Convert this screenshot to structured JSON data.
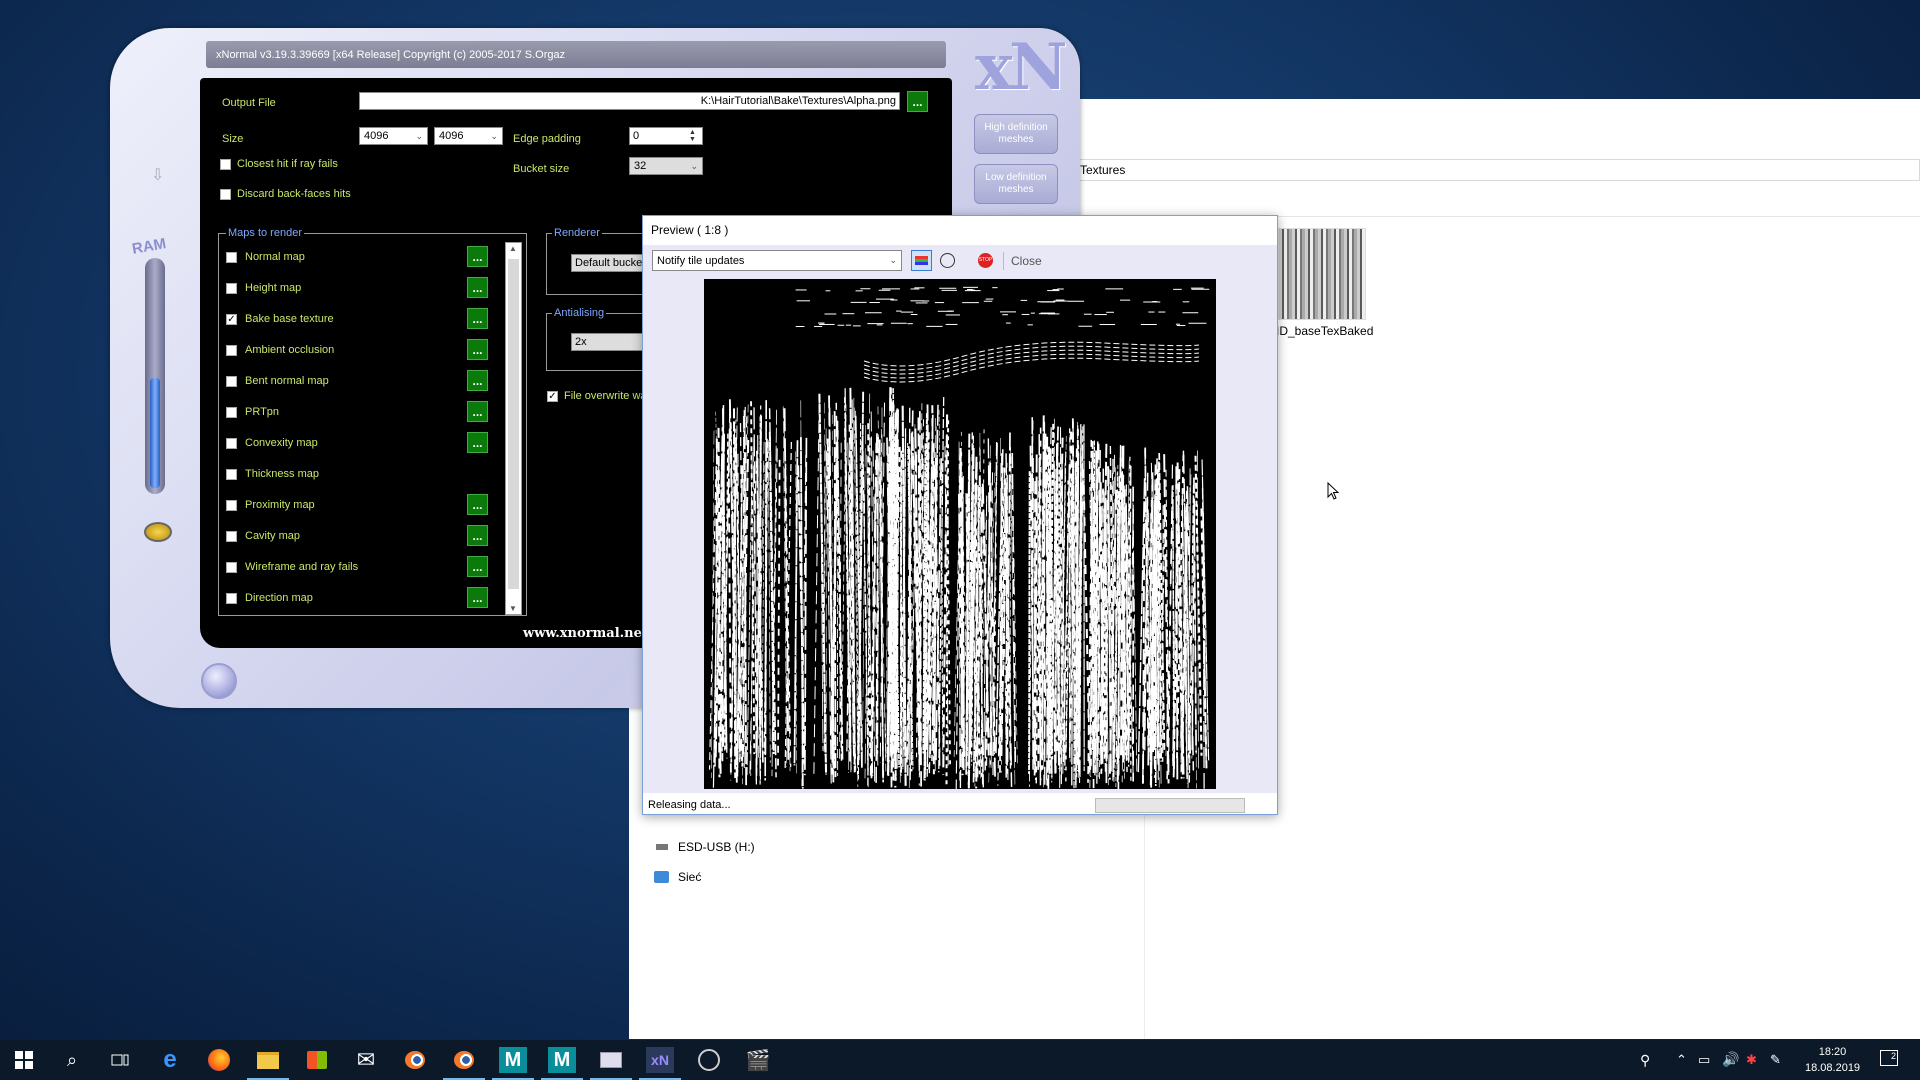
{
  "xnormal": {
    "title": "xNormal v3.19.3.39669 [x64 Release] Copyright (c) 2005-2017 S.Orgaz",
    "logo": "xN",
    "output_file_label": "Output File",
    "output_file_value": "K:\\HairTutorial\\Bake\\Textures\\Alpha.png",
    "browse_label": "...",
    "size_label": "Size",
    "size_w": "4096",
    "size_h": "4096",
    "edge_padding_label": "Edge padding",
    "edge_padding_value": "0",
    "bucket_size_label": "Bucket size",
    "bucket_size_value": "32",
    "closest_hit_label": "Closest hit if ray fails",
    "discard_backfaces_label": "Discard back-faces hits",
    "maps_group_label": "Maps to render",
    "maps": [
      {
        "label": "Normal map",
        "checked": false,
        "has_options": true
      },
      {
        "label": "Height map",
        "checked": false,
        "has_options": true
      },
      {
        "label": "Bake base texture",
        "checked": true,
        "has_options": true
      },
      {
        "label": "Ambient occlusion",
        "checked": false,
        "has_options": true
      },
      {
        "label": "Bent normal map",
        "checked": false,
        "has_options": true
      },
      {
        "label": "PRTpn",
        "checked": false,
        "has_options": true
      },
      {
        "label": "Convexity map",
        "checked": false,
        "has_options": true
      },
      {
        "label": "Thickness map",
        "checked": false,
        "has_options": false
      },
      {
        "label": "Proximity map",
        "checked": false,
        "has_options": true
      },
      {
        "label": "Cavity map",
        "checked": false,
        "has_options": true
      },
      {
        "label": "Wireframe and ray fails",
        "checked": false,
        "has_options": true
      },
      {
        "label": "Direction map",
        "checked": false,
        "has_options": true
      }
    ],
    "renderer_label": "Renderer",
    "renderer_value": "Default bucke",
    "antialiasing_label": "Antialising",
    "antialiasing_value": "2x",
    "file_overwrite_label": "File overwrite wa",
    "ram_label": "RAM",
    "ram_level": 0.5,
    "high_def_btn": "High definition meshes",
    "low_def_btn": "Low definition meshes",
    "website": "www.xnormal.net"
  },
  "preview": {
    "title": "Preview ( 1:8 )",
    "notify_select": "Notify tile updates",
    "close_label": "Close",
    "status": "Releasing data..."
  },
  "explorer": {
    "address": "Textures",
    "drives": [
      "ESD-USB (H:)",
      "Sieć"
    ],
    "thumb_label": "ID_baseTexBaked"
  },
  "taskbar": {
    "icons": [
      "windows-start",
      "search",
      "task-view",
      "edge",
      "firefox",
      "file-explorer",
      "store",
      "mail",
      "blender",
      "blender",
      "maya",
      "maya",
      "app",
      "xnormal",
      "obs",
      "clapper"
    ],
    "time": "18:20",
    "date": "18.08.2019",
    "notification_count": "2"
  },
  "colors": {
    "label_green": "#c9e76a",
    "group_blue": "#7fa8ff",
    "button_green": "#0a7a0a"
  }
}
